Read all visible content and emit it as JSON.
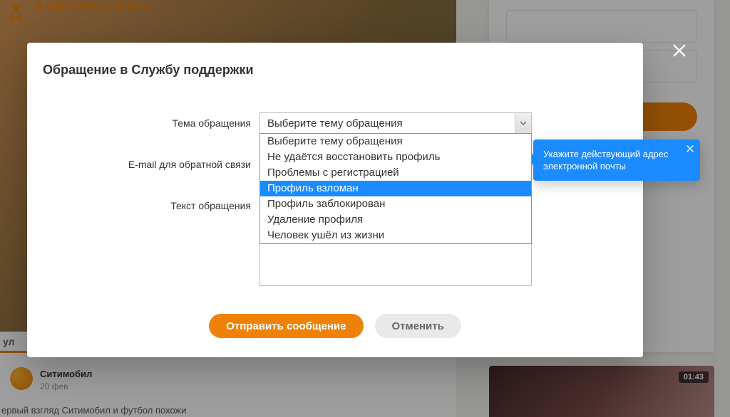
{
  "bg": {
    "hero_ribbon": "В ОДНОКЛАССНИКАХ!",
    "feed_title": "Ситимобил",
    "feed_date": "20 фев",
    "feed_snippet": "ервый взгляд Ситимобил и футбол похожи",
    "popular_tab": "ул",
    "video_badge": "01:43"
  },
  "modal": {
    "title": "Обращение в Службу поддержки",
    "labels": {
      "subject": "Тема обращения",
      "email": "E-mail для обратной связи",
      "text": "Текст обращения"
    },
    "subject_select": {
      "selected": "Выберите тему обращения",
      "options": [
        "Выберите тему обращения",
        "Не удаётся восстановить профиль",
        "Проблемы с регистрацией",
        "Профиль взломан",
        "Профиль заблокирован",
        "Удаление профиля",
        "Человек ушёл из жизни"
      ],
      "highlighted_index": 3
    },
    "buttons": {
      "submit": "Отправить сообщение",
      "cancel": "Отменить"
    }
  },
  "tooltip": {
    "text": "Укажите действующий адрес электронной почты"
  }
}
